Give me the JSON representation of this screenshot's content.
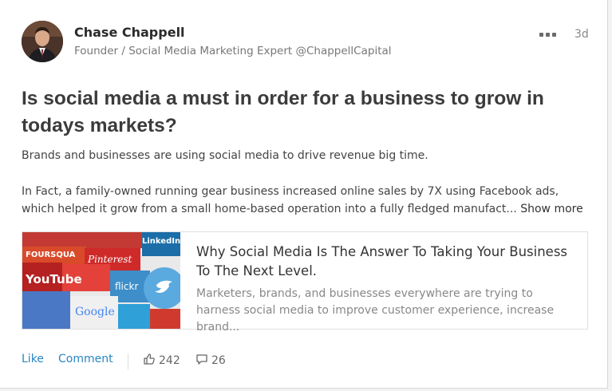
{
  "post": {
    "author": {
      "name": "Chase Chappell",
      "headline": "Founder / Social Media Marketing Expert @ChappellCapital"
    },
    "time_ago": "3d",
    "title_bold": "Is social media a must in order for a business to grow in",
    "title_tail": "todays markets?",
    "paragraph_1": "Brands and businesses are using social media to drive revenue big time.",
    "paragraph_2": "In Fact, a family-owned running gear business increased online sales by 7X using Facebook ads, which helped it grow from a small home-based operation into a fully fledged manufact...",
    "show_more_label": "Show more"
  },
  "link_preview": {
    "title": "Why Social Media Is The Answer To Taking Your Business To The Next Level.",
    "description": "Marketers, brands, and businesses everywhere are trying to harness social media to improve customer experience, increase brand...",
    "thumbnail_text": [
      "FOURSQUA",
      "Pinterest",
      "YouTube",
      "flickr",
      "Google",
      "LinkedIn"
    ]
  },
  "actions": {
    "like_label": "Like",
    "comment_label": "Comment",
    "like_count": "242",
    "comment_count": "26"
  },
  "colors": {
    "link_blue": "#2a86c2",
    "title_text": "#3b3b3b",
    "muted_text": "#888888"
  }
}
